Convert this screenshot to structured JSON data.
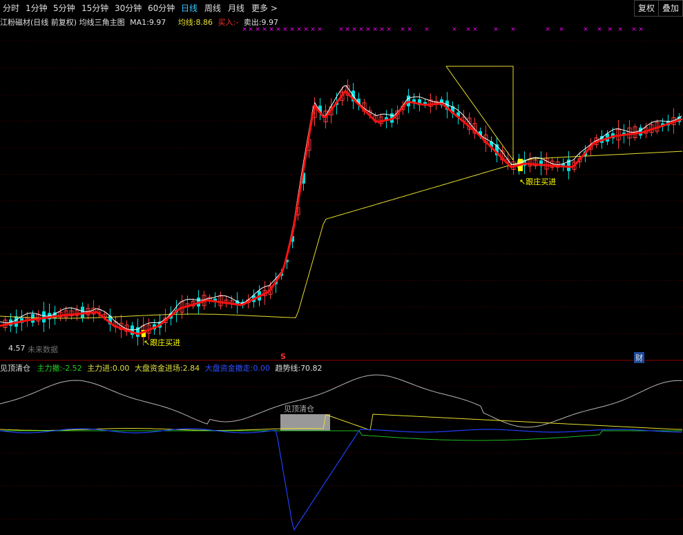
{
  "toolbar": {
    "periods": [
      "分时",
      "1分钟",
      "5分钟",
      "15分钟",
      "30分钟",
      "60分钟",
      "日线",
      "周线",
      "月线"
    ],
    "active": "日线",
    "more": "更多 >",
    "fuquan": "复权",
    "diejia": "叠加"
  },
  "header": {
    "stock": "江粉磁材(日线 前复权) 均线三角主图",
    "ma1_label": "MA1:",
    "ma1_value": "9.97",
    "junxian_label": "均线:",
    "junxian_value": "8.86",
    "buy_label": "买入:",
    "buy_value": "-",
    "sell_label": "卖出:",
    "sell_value": "9.97"
  },
  "price_chart": {
    "annotation_buy1": "↖跟庄买进",
    "annotation_buy2": "↖跟庄买进",
    "low_label": "4.57",
    "future_label": "未来数据",
    "s_marker": "S",
    "cai_marker": "财"
  },
  "indicator": {
    "title": "见顶清仓",
    "zl_san_label": "主力撤:",
    "zl_san_value": "-2.52",
    "zl_jin_label": "主力进:",
    "zl_jin_value": "0.00",
    "dp_jin_label": "大盘资金进场:",
    "dp_jin_value": "2.84",
    "dp_zou_label": "大盘资金撤走:",
    "dp_zou_value": "0.00",
    "trend_label": "趋势线:",
    "trend_value": "70.82",
    "box_label": "见顶清仓"
  },
  "colors": {
    "up": "#ff3c3c",
    "down": "#00e0e0",
    "ma_red": "#ff1010",
    "ma_yellow": "#e8e030",
    "ma_white": "#ffffff",
    "label_yellow": "#ffff00",
    "mark_magenta": "#ff00ff",
    "blue": "#2040ff",
    "green": "#20c020",
    "gray": "#b8b8b8"
  }
}
